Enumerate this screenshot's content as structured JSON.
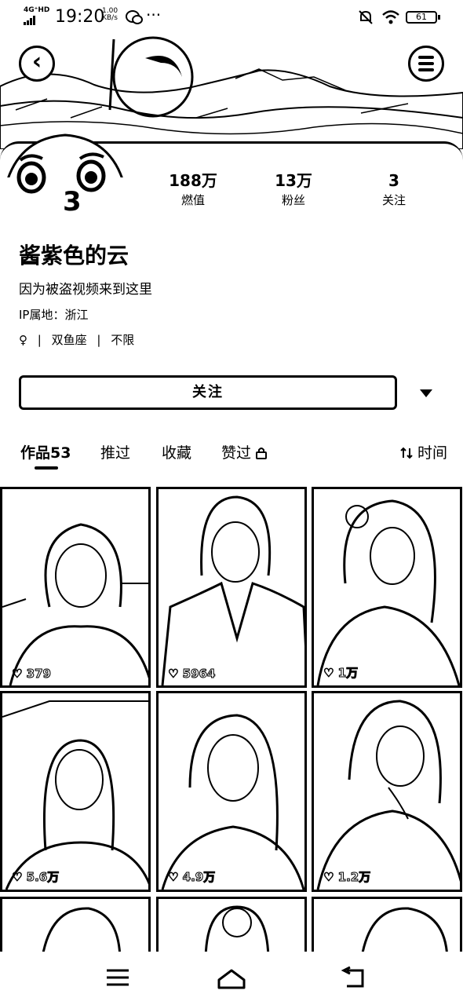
{
  "status_bar": {
    "network": "4G⁺HD",
    "time": "19:20",
    "speed_value": "1.00",
    "speed_unit": "KB/s",
    "more": "···",
    "battery": "61",
    "icons": [
      "signal-icon",
      "wechat-icon",
      "mute-bell-icon",
      "wifi-icon",
      "battery-icon"
    ]
  },
  "header": {
    "back_icon": "back-arrow-icon",
    "menu_icon": "menu-icon"
  },
  "stats": [
    {
      "value": "188万",
      "label": "燃值"
    },
    {
      "value": "13万",
      "label": "粉丝"
    },
    {
      "value": "3",
      "label": "关注"
    }
  ],
  "profile": {
    "name": "酱紫色的云",
    "bio": "因为被盗视频来到这里",
    "ip": "IP属地：浙江",
    "tags": [
      "♀",
      "|",
      "双鱼座",
      "|",
      "不限"
    ]
  },
  "actions": {
    "follow_label": "关注",
    "more_icon": "caret-down-icon"
  },
  "tabs": [
    {
      "label": "作品53",
      "active": true
    },
    {
      "label": "推过",
      "active": false
    },
    {
      "label": "收藏",
      "active": false
    },
    {
      "label": "赞过",
      "active": false
    }
  ],
  "sort_label": "时间",
  "videos": [
    {
      "likes": "379"
    },
    {
      "likes": "5964"
    },
    {
      "likes": "1万"
    },
    {
      "likes": "5.6万"
    },
    {
      "likes": "4.9万"
    },
    {
      "likes": "1.2万"
    }
  ]
}
